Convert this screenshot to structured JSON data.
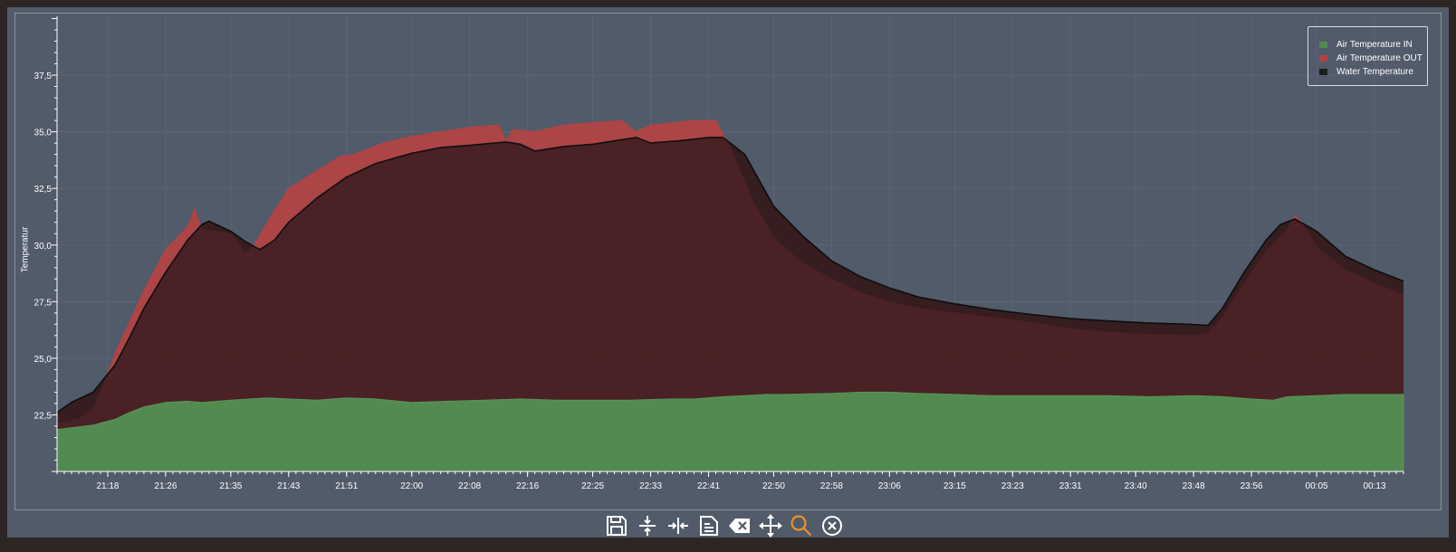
{
  "chart_data": {
    "type": "area",
    "ylabel": "Temperatur",
    "ylim": [
      20.0,
      40.1
    ],
    "y_ticks": [
      "22,5",
      "25,0",
      "27,5",
      "30,0",
      "32,5",
      "35,0",
      "37,5"
    ],
    "x_ticks": [
      "21:18",
      "21:26",
      "21:35",
      "21:43",
      "21:51",
      "22:00",
      "22:08",
      "22:16",
      "22:25",
      "22:33",
      "22:41",
      "22:50",
      "22:58",
      "23:06",
      "23:15",
      "23:23",
      "23:31",
      "23:40",
      "23:48",
      "23:56",
      "00:05",
      "00:13"
    ],
    "x_tick_times": [
      "21:18",
      "21:26",
      "21:35",
      "21:43",
      "21:51",
      "22:00",
      "22:08",
      "22:16",
      "22:25",
      "22:33",
      "22:41",
      "22:50",
      "22:58",
      "23:06",
      "23:15",
      "23:23",
      "23:31",
      "23:40",
      "23:48",
      "23:56",
      "00:05",
      "00:13"
    ],
    "x_range": [
      "21:11",
      "00:17"
    ],
    "grid": true,
    "legend_position": "top-right",
    "series": [
      {
        "name": "Air Temperature IN",
        "color": "#528a50",
        "points": [
          [
            "21:11",
            21.85
          ],
          [
            "21:16",
            22.05
          ],
          [
            "21:19",
            22.3
          ],
          [
            "21:21",
            22.6
          ],
          [
            "21:23",
            22.85
          ],
          [
            "21:26",
            23.05
          ],
          [
            "21:29",
            23.1
          ],
          [
            "21:31",
            23.05
          ],
          [
            "21:35",
            23.15
          ],
          [
            "21:40",
            23.25
          ],
          [
            "21:43",
            23.2
          ],
          [
            "21:47",
            23.15
          ],
          [
            "21:51",
            23.25
          ],
          [
            "21:55",
            23.2
          ],
          [
            "22:00",
            23.05
          ],
          [
            "22:05",
            23.1
          ],
          [
            "22:10",
            23.15
          ],
          [
            "22:15",
            23.2
          ],
          [
            "22:20",
            23.15
          ],
          [
            "22:25",
            23.15
          ],
          [
            "22:30",
            23.15
          ],
          [
            "22:36",
            23.2
          ],
          [
            "22:39",
            23.2
          ],
          [
            "22:43",
            23.3
          ],
          [
            "22:46",
            23.35
          ],
          [
            "22:49",
            23.4
          ],
          [
            "22:52",
            23.4
          ],
          [
            "22:58",
            23.45
          ],
          [
            "23:02",
            23.5
          ],
          [
            "23:06",
            23.5
          ],
          [
            "23:10",
            23.45
          ],
          [
            "23:15",
            23.4
          ],
          [
            "23:20",
            23.35
          ],
          [
            "23:25",
            23.35
          ],
          [
            "23:31",
            23.35
          ],
          [
            "23:36",
            23.35
          ],
          [
            "23:42",
            23.3
          ],
          [
            "23:48",
            23.35
          ],
          [
            "23:52",
            23.3
          ],
          [
            "23:56",
            23.2
          ],
          [
            "23:59",
            23.15
          ],
          [
            "00:01",
            23.3
          ],
          [
            "00:05",
            23.35
          ],
          [
            "00:09",
            23.4
          ],
          [
            "00:13",
            23.4
          ],
          [
            "00:17",
            23.4
          ]
        ]
      },
      {
        "name": "Air Temperature OUT",
        "color": "#b24345",
        "points": [
          [
            "21:11",
            22.1
          ],
          [
            "21:14",
            22.3
          ],
          [
            "21:16",
            22.8
          ],
          [
            "21:17",
            23.5
          ],
          [
            "21:19",
            25.2
          ],
          [
            "21:21",
            26.6
          ],
          [
            "21:23",
            28.0
          ],
          [
            "21:26",
            29.8
          ],
          [
            "21:29",
            30.8
          ],
          [
            "21:30",
            31.6
          ],
          [
            "21:31",
            30.7
          ],
          [
            "21:35",
            30.5
          ],
          [
            "21:37",
            29.6
          ],
          [
            "21:38",
            29.9
          ],
          [
            "21:41",
            31.5
          ],
          [
            "21:43",
            32.5
          ],
          [
            "21:47",
            33.3
          ],
          [
            "21:50",
            33.9
          ],
          [
            "21:52",
            34.0
          ],
          [
            "21:56",
            34.5
          ],
          [
            "22:00",
            34.8
          ],
          [
            "22:04",
            35.0
          ],
          [
            "22:08",
            35.2
          ],
          [
            "22:12",
            35.3
          ],
          [
            "22:13",
            34.6
          ],
          [
            "22:14",
            35.1
          ],
          [
            "22:17",
            35.0
          ],
          [
            "22:21",
            35.3
          ],
          [
            "22:25",
            35.4
          ],
          [
            "22:29",
            35.5
          ],
          [
            "22:31",
            35.0
          ],
          [
            "22:33",
            35.3
          ],
          [
            "22:36",
            35.4
          ],
          [
            "22:39",
            35.5
          ],
          [
            "22:42",
            35.5
          ],
          [
            "22:44",
            34.3
          ],
          [
            "22:47",
            32.0
          ],
          [
            "22:50",
            30.3
          ],
          [
            "22:54",
            29.2
          ],
          [
            "22:58",
            28.5
          ],
          [
            "23:02",
            27.9
          ],
          [
            "23:06",
            27.5
          ],
          [
            "23:10",
            27.2
          ],
          [
            "23:15",
            27.0
          ],
          [
            "23:20",
            26.8
          ],
          [
            "23:25",
            26.6
          ],
          [
            "23:31",
            26.3
          ],
          [
            "23:36",
            26.15
          ],
          [
            "23:42",
            26.05
          ],
          [
            "23:48",
            26.0
          ],
          [
            "23:50",
            26.1
          ],
          [
            "23:52",
            26.8
          ],
          [
            "23:55",
            28.3
          ],
          [
            "23:58",
            29.7
          ],
          [
            "00:01",
            30.7
          ],
          [
            "00:02",
            31.3
          ],
          [
            "00:03",
            31.0
          ],
          [
            "00:05",
            29.9
          ],
          [
            "00:09",
            28.9
          ],
          [
            "00:13",
            28.3
          ],
          [
            "00:17",
            27.8
          ]
        ]
      },
      {
        "name": "Water Temperature",
        "color": "#1c1d1f",
        "points": [
          [
            "21:11",
            22.6
          ],
          [
            "21:13",
            23.05
          ],
          [
            "21:16",
            23.5
          ],
          [
            "21:19",
            24.7
          ],
          [
            "21:21",
            25.9
          ],
          [
            "21:23",
            27.2
          ],
          [
            "21:26",
            28.8
          ],
          [
            "21:29",
            30.2
          ],
          [
            "21:31",
            30.9
          ],
          [
            "21:32",
            31.05
          ],
          [
            "21:35",
            30.6
          ],
          [
            "21:37",
            30.15
          ],
          [
            "21:39",
            29.8
          ],
          [
            "21:41",
            30.2
          ],
          [
            "21:43",
            31.0
          ],
          [
            "21:47",
            32.1
          ],
          [
            "21:51",
            33.0
          ],
          [
            "21:55",
            33.6
          ],
          [
            "22:00",
            34.05
          ],
          [
            "22:04",
            34.3
          ],
          [
            "22:08",
            34.4
          ],
          [
            "22:13",
            34.55
          ],
          [
            "22:15",
            34.45
          ],
          [
            "22:17",
            34.15
          ],
          [
            "22:21",
            34.35
          ],
          [
            "22:25",
            34.45
          ],
          [
            "22:29",
            34.65
          ],
          [
            "22:31",
            34.75
          ],
          [
            "22:33",
            34.5
          ],
          [
            "22:37",
            34.6
          ],
          [
            "22:41",
            34.75
          ],
          [
            "22:43",
            34.75
          ],
          [
            "22:46",
            34.0
          ],
          [
            "22:50",
            31.7
          ],
          [
            "22:54",
            30.4
          ],
          [
            "22:58",
            29.3
          ],
          [
            "23:02",
            28.6
          ],
          [
            "23:06",
            28.1
          ],
          [
            "23:10",
            27.7
          ],
          [
            "23:15",
            27.4
          ],
          [
            "23:20",
            27.15
          ],
          [
            "23:25",
            26.95
          ],
          [
            "23:31",
            26.75
          ],
          [
            "23:36",
            26.65
          ],
          [
            "23:42",
            26.55
          ],
          [
            "23:47",
            26.5
          ],
          [
            "23:50",
            26.45
          ],
          [
            "23:52",
            27.2
          ],
          [
            "23:55",
            28.8
          ],
          [
            "23:58",
            30.2
          ],
          [
            "00:00",
            30.9
          ],
          [
            "00:02",
            31.15
          ],
          [
            "00:05",
            30.6
          ],
          [
            "00:09",
            29.5
          ],
          [
            "00:13",
            28.9
          ],
          [
            "00:17",
            28.4
          ]
        ]
      }
    ]
  },
  "toolbar": [
    {
      "id": "save",
      "icon": "save-icon"
    },
    {
      "id": "zoom-y",
      "icon": "compress-vertical-icon"
    },
    {
      "id": "zoom-x",
      "icon": "compress-horizontal-icon"
    },
    {
      "id": "export",
      "icon": "report-icon"
    },
    {
      "id": "clear",
      "icon": "backspace-icon"
    },
    {
      "id": "pan",
      "icon": "move-icon"
    },
    {
      "id": "zoom",
      "icon": "magnifier-icon",
      "active_color": "#e8922a"
    },
    {
      "id": "reset",
      "icon": "close-circle-icon"
    }
  ]
}
